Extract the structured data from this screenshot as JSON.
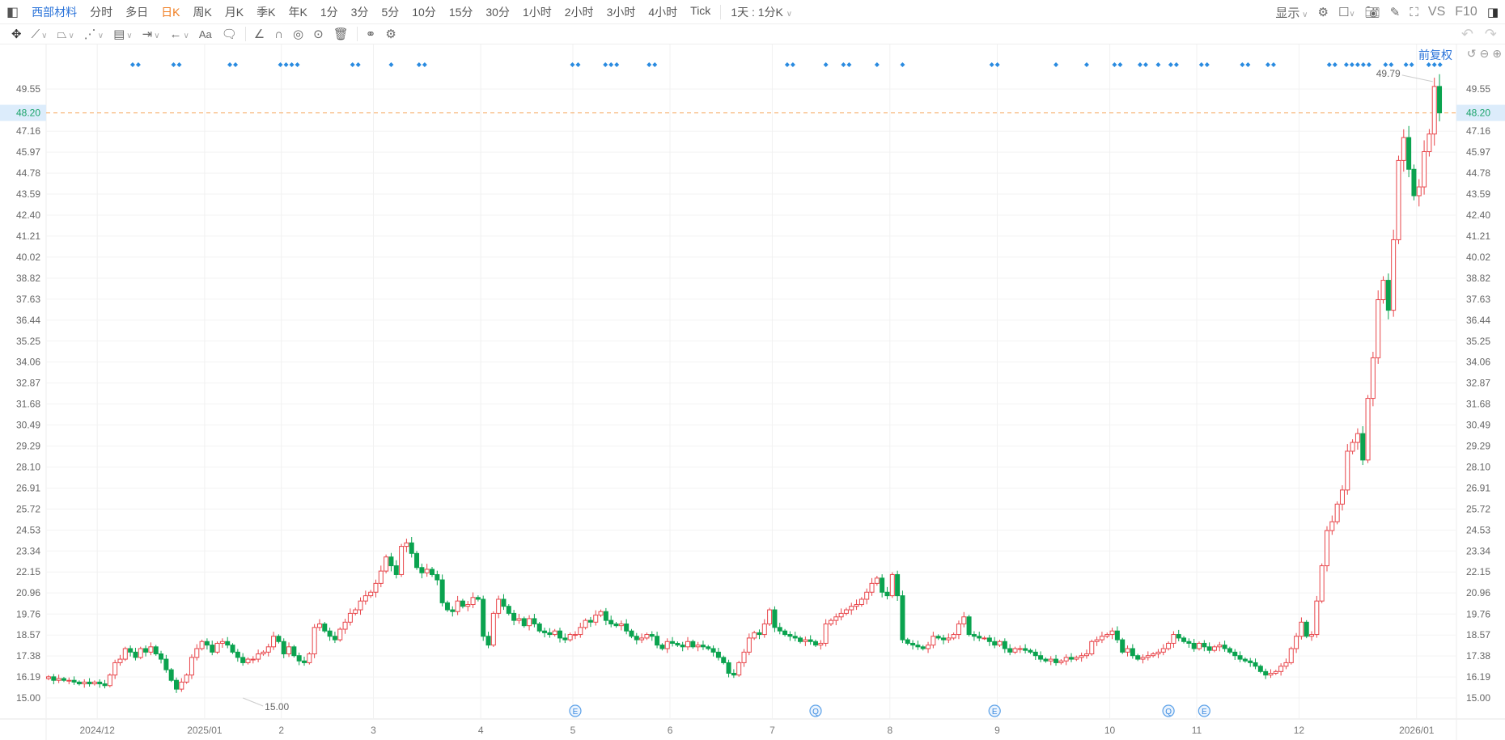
{
  "toolbar": {
    "stock_name": "西部材料",
    "periods": [
      "分时",
      "多日",
      "日K",
      "周K",
      "月K",
      "季K",
      "年K",
      "1分",
      "3分",
      "5分",
      "10分",
      "15分",
      "30分",
      "1小时",
      "2小时",
      "3小时",
      "4小时",
      "Tick"
    ],
    "active_period": "日K",
    "custom_period": "1天 : 1分K",
    "display_label": "显示",
    "vs_label": "VS",
    "f10_label": "F10",
    "adjust_label": "前复权"
  },
  "colors": {
    "up": "#e8454a",
    "down": "#0aa34f",
    "accent": "#2a73d9",
    "active": "#f07b1d",
    "price_line": "#f5a55a",
    "price_label": "#1aa36a"
  },
  "chart_data": {
    "type": "candlestick",
    "current_price": "48.20",
    "high_label": "49.79",
    "low_label": "15.00",
    "y_ticks": [
      "15.00",
      "16.19",
      "17.38",
      "18.57",
      "19.76",
      "20.96",
      "22.15",
      "23.34",
      "24.53",
      "25.72",
      "26.91",
      "28.10",
      "29.29",
      "30.49",
      "31.68",
      "32.87",
      "34.06",
      "35.25",
      "36.44",
      "37.63",
      "38.82",
      "40.02",
      "41.21",
      "42.40",
      "43.59",
      "44.78",
      "45.97",
      "47.16",
      "49.55"
    ],
    "x_labels": [
      {
        "label": "2024/12",
        "i": 10
      },
      {
        "label": "2025/01",
        "i": 31
      },
      {
        "label": "2",
        "i": 46
      },
      {
        "label": "3",
        "i": 64
      },
      {
        "label": "4",
        "i": 85
      },
      {
        "label": "5",
        "i": 103
      },
      {
        "label": "6",
        "i": 122
      },
      {
        "label": "7",
        "i": 142
      },
      {
        "label": "8",
        "i": 165
      },
      {
        "label": "9",
        "i": 186
      },
      {
        "label": "10",
        "i": 208
      },
      {
        "label": "11",
        "i": 225
      },
      {
        "label": "12",
        "i": 245
      },
      {
        "label": "2026/01",
        "i": 268
      }
    ],
    "closes": [
      16.2,
      16.0,
      16.1,
      16.0,
      16.0,
      15.9,
      15.8,
      15.9,
      15.8,
      15.9,
      15.8,
      15.7,
      16.3,
      17.0,
      17.2,
      17.8,
      17.6,
      17.3,
      17.8,
      17.6,
      17.9,
      17.5,
      17.2,
      16.6,
      16.0,
      15.5,
      15.9,
      16.3,
      17.3,
      17.8,
      18.2,
      18.0,
      17.6,
      18.1,
      18.2,
      18.0,
      17.6,
      17.3,
      17.0,
      17.2,
      17.2,
      17.5,
      17.6,
      17.9,
      18.5,
      18.2,
      17.5,
      17.9,
      17.4,
      17.1,
      17.0,
      17.5,
      19.0,
      19.2,
      18.8,
      18.5,
      18.3,
      18.9,
      19.3,
      19.8,
      20.0,
      20.5,
      20.8,
      21.0,
      21.5,
      22.2,
      23.0,
      22.5,
      22.0,
      23.6,
      23.8,
      23.2,
      22.4,
      22.1,
      22.3,
      22.0,
      21.7,
      20.4,
      20.0,
      19.9,
      20.5,
      20.2,
      20.3,
      20.7,
      20.6,
      18.5,
      18.0,
      19.8,
      20.6,
      20.2,
      19.8,
      19.4,
      19.5,
      19.1,
      19.5,
      19.2,
      18.8,
      18.7,
      18.6,
      18.8,
      18.4,
      18.3,
      18.6,
      18.6,
      19.0,
      19.4,
      19.3,
      19.7,
      19.9,
      19.4,
      19.2,
      19.1,
      19.2,
      18.8,
      18.5,
      18.3,
      18.4,
      18.6,
      18.5,
      18.0,
      17.8,
      18.2,
      18.1,
      18.0,
      17.9,
      18.2,
      17.9,
      18.0,
      17.9,
      17.8,
      17.6,
      17.3,
      17.0,
      16.4,
      16.3,
      17.0,
      17.6,
      18.4,
      18.7,
      18.6,
      19.2,
      20.0,
      19.0,
      18.8,
      18.6,
      18.5,
      18.4,
      18.2,
      18.3,
      18.2,
      18.0,
      18.1,
      19.2,
      19.4,
      19.6,
      19.8,
      20.0,
      20.2,
      20.3,
      20.6,
      21.0,
      21.5,
      21.8,
      21.0,
      20.8,
      22.0,
      20.8,
      18.3,
      18.1,
      18.0,
      17.9,
      17.8,
      18.0,
      18.5,
      18.4,
      18.3,
      18.4,
      18.6,
      19.2,
      19.6,
      18.6,
      18.5,
      18.4,
      18.4,
      18.2,
      18.0,
      18.2,
      17.8,
      17.6,
      17.8,
      17.8,
      17.7,
      17.6,
      17.4,
      17.2,
      17.1,
      17.2,
      17.0,
      17.1,
      17.3,
      17.2,
      17.3,
      17.4,
      17.5,
      18.2,
      18.3,
      18.5,
      18.6,
      18.8,
      18.3,
      17.6,
      17.8,
      17.4,
      17.2,
      17.3,
      17.4,
      17.5,
      17.6,
      17.8,
      18.1,
      18.6,
      18.4,
      18.2,
      18.1,
      17.8,
      18.1,
      17.9,
      17.7,
      17.9,
      18.0,
      17.8,
      17.6,
      17.4,
      17.2,
      17.1,
      17.0,
      16.8,
      16.5,
      16.3,
      16.4,
      16.5,
      16.8,
      17.0,
      17.8,
      18.5,
      19.3,
      18.5,
      18.6,
      20.5,
      22.5,
      24.5,
      25.0,
      26.0,
      26.8,
      29.0,
      29.5,
      30.0,
      28.5,
      32.0,
      34.3,
      37.6,
      38.7,
      37.0,
      41.0,
      45.5,
      46.8,
      45.0,
      43.5,
      44.0,
      46.0,
      47.0,
      49.7,
      48.2
    ],
    "signal_markers": [
      {
        "i": 17,
        "n": 2
      },
      {
        "i": 25,
        "n": 2
      },
      {
        "i": 36,
        "n": 2
      },
      {
        "i": 47,
        "n": 4
      },
      {
        "i": 60,
        "n": 2
      },
      {
        "i": 67,
        "n": 1
      },
      {
        "i": 73,
        "n": 2
      },
      {
        "i": 103,
        "n": 2
      },
      {
        "i": 110,
        "n": 3
      },
      {
        "i": 118,
        "n": 2
      },
      {
        "i": 145,
        "n": 2
      },
      {
        "i": 152,
        "n": 1
      },
      {
        "i": 156,
        "n": 2
      },
      {
        "i": 162,
        "n": 1
      },
      {
        "i": 167,
        "n": 1
      },
      {
        "i": 185,
        "n": 2
      },
      {
        "i": 197,
        "n": 1
      },
      {
        "i": 203,
        "n": 1
      },
      {
        "i": 209,
        "n": 2
      },
      {
        "i": 214,
        "n": 2
      },
      {
        "i": 217,
        "n": 1
      },
      {
        "i": 220,
        "n": 2
      },
      {
        "i": 226,
        "n": 2
      },
      {
        "i": 234,
        "n": 2
      },
      {
        "i": 239,
        "n": 2
      },
      {
        "i": 251,
        "n": 2
      },
      {
        "i": 256,
        "n": 5
      },
      {
        "i": 262,
        "n": 2
      },
      {
        "i": 266,
        "n": 2
      },
      {
        "i": 271,
        "n": 3
      }
    ],
    "events": [
      {
        "i": 103,
        "label": "E"
      },
      {
        "i": 150,
        "label": "Q"
      },
      {
        "i": 185,
        "label": "E"
      },
      {
        "i": 219,
        "label": "Q"
      },
      {
        "i": 226,
        "label": "E"
      }
    ]
  }
}
